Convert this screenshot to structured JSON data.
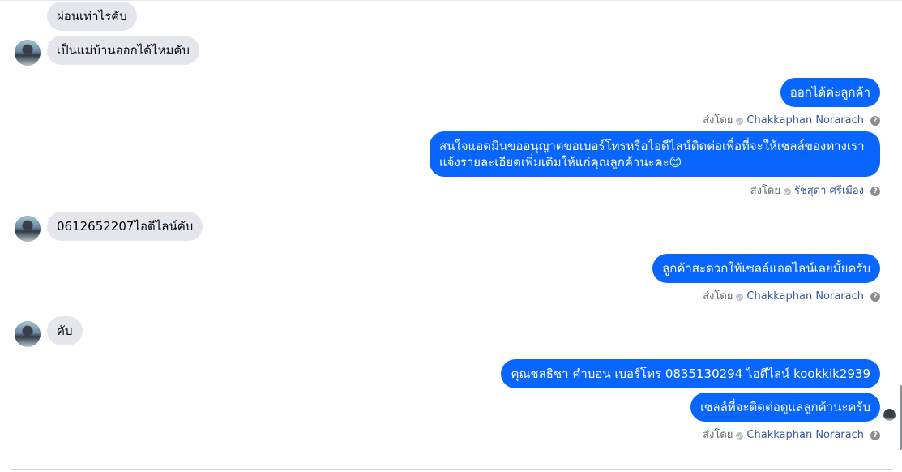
{
  "messages": [
    {
      "side": "in",
      "text": "ผ่อนเท่าไรคับ"
    },
    {
      "side": "in",
      "text": "เป็นแม่บ้านออกได้ไหมคับ"
    },
    {
      "side": "out",
      "text": "ออกได้ค่ะลูกค้า"
    },
    {
      "side": "out",
      "text": "สนใจแอดมินขออนุญาตขอเบอร์โทรหรือไอดีไลน์ติดต่อเพื่อที่จะให้เซลล์ของทางเราแจ้งรายละเอียดเพิ่มเติมให้แก่คุณลูกค้านะคะ😊"
    },
    {
      "side": "in",
      "text": "0612652207ไอดีไลน์คับ"
    },
    {
      "side": "out",
      "text": "ลูกค้าสะดวกให้เซลล์แอดไลน์เลยมั้ยครับ"
    },
    {
      "side": "in",
      "text": "คับ"
    },
    {
      "side": "out",
      "text": "คุณชลธิชา คำบอน  เบอร์โทร 0835130294  ไอดีไลน์ kookkik2939"
    },
    {
      "side": "out",
      "text": "เซลล์ที่จะติดต่อดูแลลูกค้านะครับ"
    }
  ],
  "sent_by": {
    "prefix": "ส่งโดย",
    "help": "?",
    "names": [
      "Chakkaphan Norarach",
      "รัชสุดา ศรีเมือง",
      "Chakkaphan Norarach",
      "Chakkaphan Norarach"
    ]
  }
}
